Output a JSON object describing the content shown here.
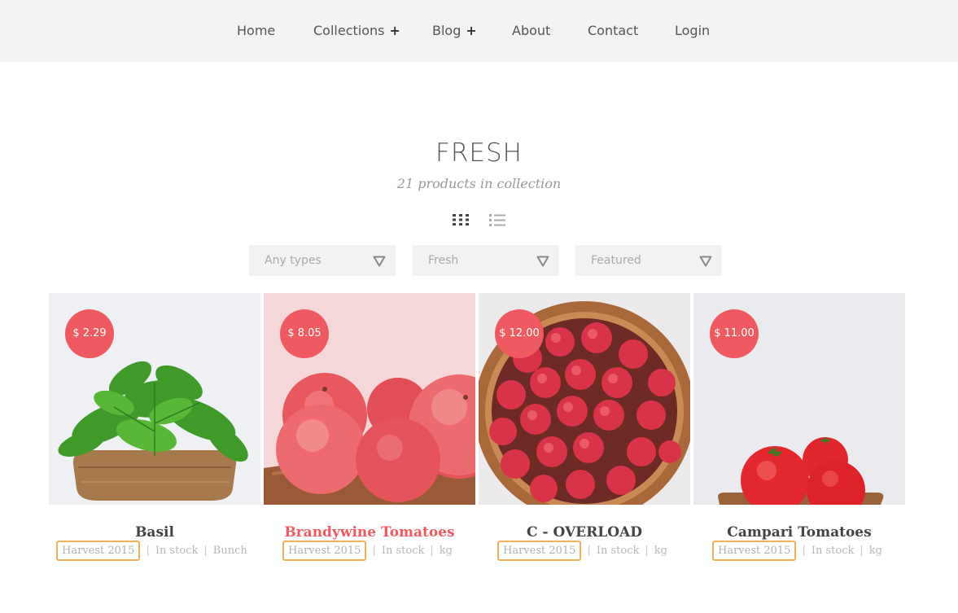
{
  "nav": {
    "items": [
      {
        "label": "Home",
        "has_submenu": false
      },
      {
        "label": "Collections",
        "has_submenu": true
      },
      {
        "label": "Blog",
        "has_submenu": true
      },
      {
        "label": "About",
        "has_submenu": false
      },
      {
        "label": "Contact",
        "has_submenu": false
      },
      {
        "label": "Login",
        "has_submenu": false
      }
    ],
    "submenu_icon": "+"
  },
  "collection": {
    "title": "FRESH",
    "count_text": "21 products in collection"
  },
  "view_toggle": {
    "grid_icon": "grid-view-icon",
    "list_icon": "list-view-icon"
  },
  "filters": [
    {
      "value": "Any types"
    },
    {
      "value": "Fresh"
    },
    {
      "value": "Featured"
    }
  ],
  "products": [
    {
      "name": "Basil",
      "price": "$ 2.29",
      "tag": "Harvest 2015",
      "stock": "In stock",
      "unit": "Bunch",
      "highlighted": false
    },
    {
      "name": "Brandywine Tomatoes",
      "price": "$ 8.05",
      "tag": "Harvest 2015",
      "stock": "In stock",
      "unit": "kg",
      "highlighted": true
    },
    {
      "name": "C - OVERLOAD",
      "price": "$ 12.00",
      "tag": "Harvest 2015",
      "stock": "In stock",
      "unit": "kg",
      "highlighted": false
    },
    {
      "name": "Campari Tomatoes",
      "price": "$ 11.00",
      "tag": "Harvest 2015",
      "stock": "In stock",
      "unit": "kg",
      "highlighted": false
    }
  ],
  "colors": {
    "accent": "#ee5a5f",
    "tag_border": "#f0b05a",
    "nav_bg": "#f4f3f3"
  }
}
